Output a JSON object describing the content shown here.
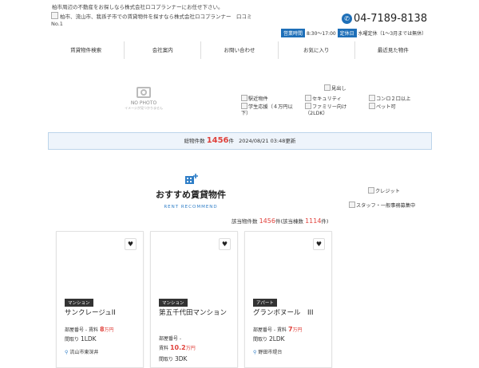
{
  "header": {
    "tagline": "柏市周辺の不動産をお探しなら株式会社ロコプランナーにお任せ下さい。",
    "logo_alt": "柏市、流山市、我孫子市での賃貸物件を探すなら株式会社ロコプランナー　口コミNo.1",
    "phone": "04-7189-8138",
    "hours_badge": "営業時間",
    "hours": "8:30～17:00",
    "holiday_badge": "定休日",
    "holiday": "水曜定休（1～3月までは無休）"
  },
  "nav": [
    "賃貸物件検索",
    "会社案内",
    "お問い合わせ",
    "お気に入り",
    "最近見た物件"
  ],
  "search": {
    "nophoto_title": "NO PHOTO",
    "nophoto_sub": "イメージが見つかりません",
    "midashi": "見出し",
    "features": [
      "駅近物件",
      "セキュリティ",
      "コンロ２口以上",
      "学生応援（４万円以下）",
      "ファミリー向け（2LDK）",
      "ペット可"
    ]
  },
  "total": {
    "label": "総物件数",
    "count": "1456",
    "unit": "件",
    "updated": "2024/08/21 03:48更新"
  },
  "recommend": {
    "title": "おすすめ賃貸物件",
    "subtitle": "RENT RECOMMEND",
    "count_prefix": "該当物件数",
    "count": "1456",
    "count_suffix": "件(該当棟数",
    "buildings": "1114",
    "buildings_suffix": "件)"
  },
  "sidebar": {
    "credit": "クレジット",
    "staff": "スタッフ・一般事務募集中"
  },
  "cards": [
    {
      "type": "マンション",
      "name": "サンクレージュII",
      "room": "部屋番号 -",
      "rent_label": "賃料",
      "rent": "8",
      "rent_unit": "万円",
      "layout_label": "間取り",
      "layout": "1LDK",
      "address": "流山市東深井"
    },
    {
      "type": "マンション",
      "name": "第五千代田マンション",
      "room": "部屋番号 -",
      "rent_label": "賃料",
      "rent": "10.2",
      "rent_unit": "万円",
      "layout_label": "間取り",
      "layout": "3DK",
      "address": ""
    },
    {
      "type": "アパート",
      "name": "グランボヌール　III",
      "room": "部屋番号 -",
      "rent_label": "賃料",
      "rent": "7",
      "rent_unit": "万円",
      "layout_label": "間取り",
      "layout": "2LDK",
      "address": "野田市堤台"
    }
  ],
  "colors": {
    "accent": "#1e6fb8",
    "price": "#e0413b",
    "link": "#2f7ec7"
  }
}
